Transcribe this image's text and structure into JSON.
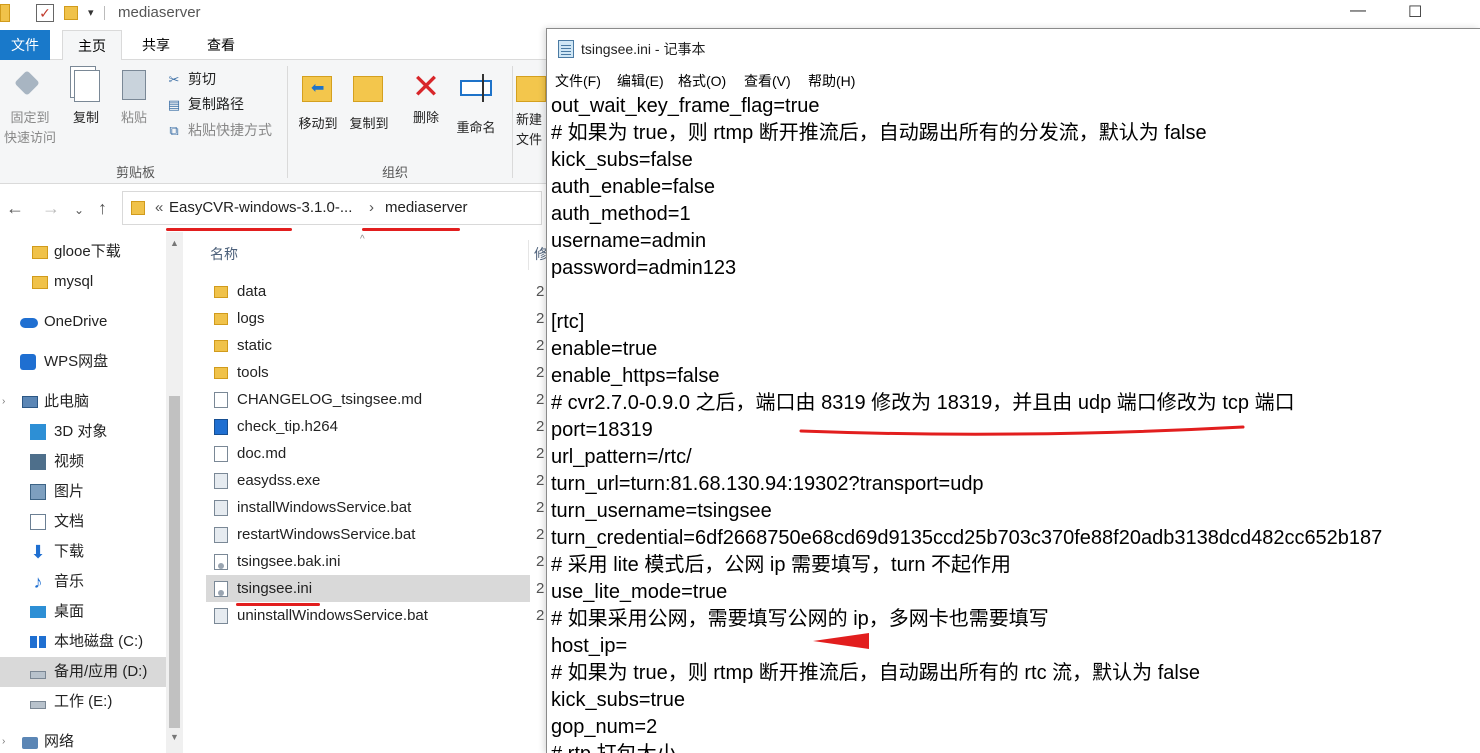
{
  "explorer": {
    "title": "mediaserver",
    "window_controls": {
      "minimize": "—",
      "maximize": "☐"
    },
    "ribbon_tabs": [
      "文件",
      "主页",
      "共享",
      "查看"
    ],
    "clipboard": {
      "pin_label_1": "固定到",
      "pin_label_2": "快速访问",
      "copy": "复制",
      "paste": "粘贴",
      "cut": "剪切",
      "copy_path": "复制路径",
      "paste_shortcut": "粘贴快捷方式",
      "group_label": "剪贴板"
    },
    "organize": {
      "move_to": "移动到",
      "copy_to": "复制到",
      "delete": "删除",
      "rename": "重命名",
      "group_label": "组织"
    },
    "new_group": {
      "label_1": "新建",
      "label_2": "文件"
    },
    "address": {
      "prefix": "«",
      "crumb1": "EasyCVR-windows-3.1.0-...",
      "separator": "›",
      "crumb2": "mediaserver"
    },
    "nav_pane": [
      {
        "label": "glooe下载",
        "icon": "folder-icon"
      },
      {
        "label": "mysql",
        "icon": "folder-icon"
      },
      {
        "label": "OneDrive",
        "icon": "onedrive-cloud-icon"
      },
      {
        "label": "WPS网盘",
        "icon": "wps-cloud-icon"
      },
      {
        "label": "此电脑",
        "icon": "computer-icon"
      },
      {
        "label": "3D 对象",
        "icon": "3d-objects-icon"
      },
      {
        "label": "视频",
        "icon": "video-icon"
      },
      {
        "label": "图片",
        "icon": "pictures-icon"
      },
      {
        "label": "文档",
        "icon": "documents-icon"
      },
      {
        "label": "下载",
        "icon": "download-icon"
      },
      {
        "label": "音乐",
        "icon": "music-icon"
      },
      {
        "label": "桌面",
        "icon": "desktop-icon"
      },
      {
        "label": "本地磁盘 (C:)",
        "icon": "windows-drive-icon"
      },
      {
        "label": "备用/应用 (D:)",
        "icon": "drive-icon"
      },
      {
        "label": "工作 (E:)",
        "icon": "drive-icon"
      },
      {
        "label": "网络",
        "icon": "network-icon"
      }
    ],
    "files": {
      "column_name": "名称",
      "column_date_fragment": "修",
      "date_fragment": "2",
      "items": [
        {
          "name": "data",
          "type": "folder"
        },
        {
          "name": "logs",
          "type": "folder"
        },
        {
          "name": "static",
          "type": "folder"
        },
        {
          "name": "tools",
          "type": "folder"
        },
        {
          "name": "CHANGELOG_tsingsee.md",
          "type": "text"
        },
        {
          "name": "check_tip.h264",
          "type": "media"
        },
        {
          "name": "doc.md",
          "type": "text"
        },
        {
          "name": "easydss.exe",
          "type": "exe"
        },
        {
          "name": "installWindowsService.bat",
          "type": "bat"
        },
        {
          "name": "restartWindowsService.bat",
          "type": "bat"
        },
        {
          "name": "tsingsee.bak.ini",
          "type": "ini"
        },
        {
          "name": "tsingsee.ini",
          "type": "ini",
          "selected": true
        },
        {
          "name": "uninstallWindowsService.bat",
          "type": "bat"
        }
      ]
    },
    "annotation_color": "#e21e1e"
  },
  "notepad": {
    "title": "tsingsee.ini - 记事本",
    "menu": [
      "文件(F)",
      "编辑(E)",
      "格式(O)",
      "查看(V)",
      "帮助(H)"
    ],
    "lines": [
      "out_wait_key_frame_flag=true",
      "# 如果为 true，则 rtmp 断开推流后，自动踢出所有的分发流，默认为 false",
      "kick_subs=false",
      "auth_enable=false",
      "auth_method=1",
      "username=admin",
      "password=admin123",
      "",
      "[rtc]",
      "enable=true",
      "enable_https=false",
      "# cvr2.7.0-0.9.0 之后，端口由 8319 修改为 18319，并且由 udp 端口修改为 tcp 端口",
      "port=18319",
      "url_pattern=/rtc/",
      "turn_url=turn:81.68.130.94:19302?transport=udp",
      "turn_username=tsingsee",
      "turn_credential=6df2668750e68cd69d9135ccd25b703c370fe88f20adb3138dcd482cc652b187",
      "# 采用 lite 模式后，公网 ip 需要填写，turn 不起作用",
      "use_lite_mode=true",
      "# 如果采用公网，需要填写公网的 ip，多网卡也需要填写",
      "host_ip=",
      "# 如果为 true，则 rtmp 断开推流后，自动踢出所有的 rtc 流，默认为 false",
      "kick_subs=true",
      "gop_num=2",
      "# rtp 打包大小"
    ]
  }
}
